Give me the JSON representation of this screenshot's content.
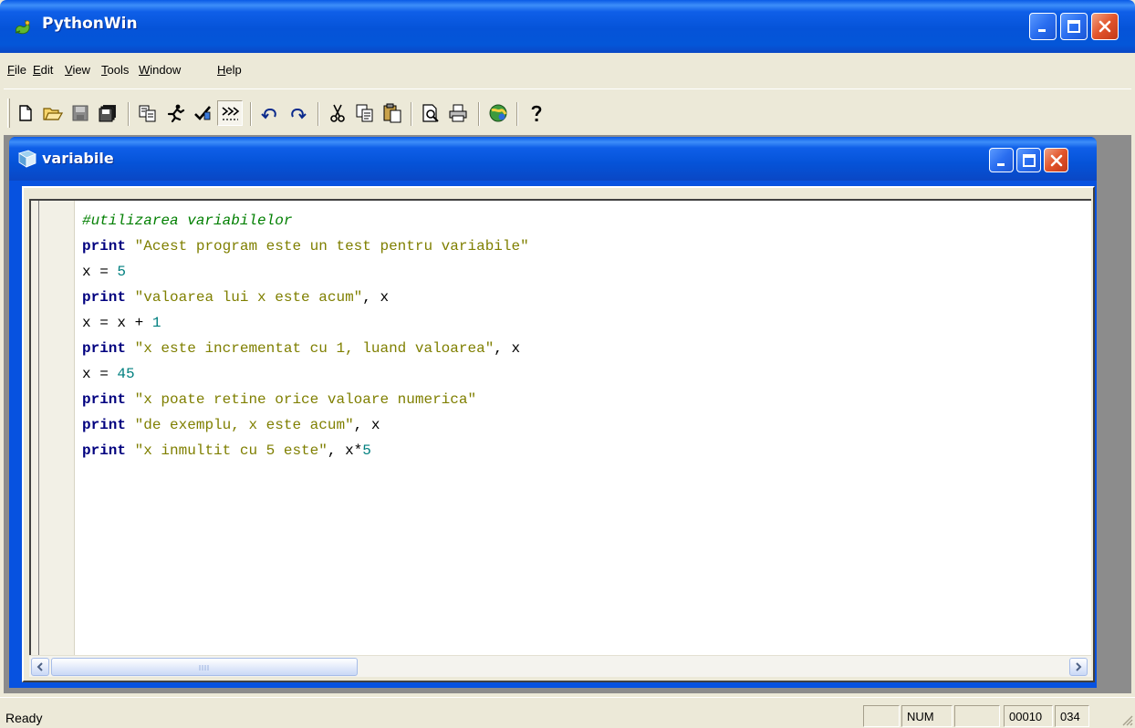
{
  "app": {
    "title": "PythonWin",
    "colors": {
      "titlebar": "#0553D8",
      "close": "#E2542A"
    }
  },
  "menu": {
    "items": [
      "File",
      "Edit",
      "View",
      "Tools",
      "Window",
      "Help"
    ]
  },
  "toolbar": {
    "buttons": [
      "new-file-icon",
      "open-folder-icon",
      "save-icon",
      "save-all-icon",
      "copy-screen-icon",
      "run-icon",
      "check-icon",
      "whitespace-toggle-icon",
      "undo-icon",
      "redo-icon",
      "cut-icon",
      "copy-icon",
      "paste-icon",
      "print-preview-icon",
      "print-icon",
      "browser-icon",
      "help-icon"
    ]
  },
  "document": {
    "title": "variabile",
    "lines": [
      [
        {
          "t": "comment",
          "v": "#utilizarea variabilelor"
        }
      ],
      [
        {
          "t": "kw",
          "v": "print"
        },
        {
          "t": "op",
          "v": " "
        },
        {
          "t": "str",
          "v": "\"Acest program este un test pentru variabile\""
        }
      ],
      [
        {
          "t": "op",
          "v": "x = "
        },
        {
          "t": "num",
          "v": "5"
        }
      ],
      [
        {
          "t": "kw",
          "v": "print"
        },
        {
          "t": "op",
          "v": " "
        },
        {
          "t": "str",
          "v": "\"valoarea lui x este acum\""
        },
        {
          "t": "op",
          "v": ", x"
        }
      ],
      [
        {
          "t": "op",
          "v": "x = x + "
        },
        {
          "t": "num",
          "v": "1"
        }
      ],
      [
        {
          "t": "kw",
          "v": "print"
        },
        {
          "t": "op",
          "v": " "
        },
        {
          "t": "str",
          "v": "\"x este incrementat cu 1, luand valoarea\""
        },
        {
          "t": "op",
          "v": ", x"
        }
      ],
      [
        {
          "t": "op",
          "v": "x = "
        },
        {
          "t": "num",
          "v": "45"
        }
      ],
      [
        {
          "t": "kw",
          "v": "print"
        },
        {
          "t": "op",
          "v": " "
        },
        {
          "t": "str",
          "v": "\"x poate retine orice valoare numerica\""
        }
      ],
      [
        {
          "t": "kw",
          "v": "print"
        },
        {
          "t": "op",
          "v": " "
        },
        {
          "t": "str",
          "v": "\"de exemplu, x este acum\""
        },
        {
          "t": "op",
          "v": ", x"
        }
      ],
      [
        {
          "t": "kw",
          "v": "print"
        },
        {
          "t": "op",
          "v": " "
        },
        {
          "t": "str",
          "v": "\"x inmultit cu 5 este\""
        },
        {
          "t": "op",
          "v": ", x*"
        },
        {
          "t": "num",
          "v": "5"
        }
      ]
    ]
  },
  "status": {
    "message": "Ready",
    "num": "NUM",
    "line": "00010",
    "col": "034"
  }
}
